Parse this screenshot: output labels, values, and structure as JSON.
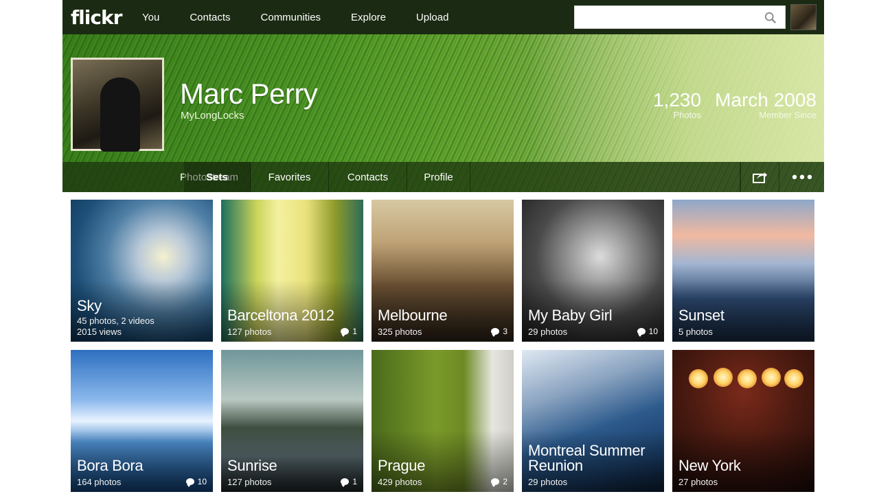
{
  "nav": {
    "logo": "flickr",
    "links": [
      "You",
      "Contacts",
      "Communities",
      "Explore",
      "Upload"
    ],
    "search_placeholder": "",
    "search_value": ""
  },
  "profile": {
    "name": "Marc Perry",
    "username": "MyLongLocks",
    "stats": [
      {
        "value": "1,230",
        "label": "Photos"
      },
      {
        "value": "March 2008",
        "label": "Member Since"
      }
    ]
  },
  "tabs": {
    "items": [
      "Photostream",
      "Sets",
      "Favorites",
      "Contacts",
      "Profile"
    ],
    "active": "Sets",
    "share_icon": "share-icon",
    "more_icon": "more-icon"
  },
  "sets": [
    {
      "title": "Sky",
      "meta1": "45 photos, 2 videos",
      "meta2": "2015 views",
      "comments": ""
    },
    {
      "title": "Barceltona 2012",
      "meta1": "127 photos",
      "meta2": "",
      "comments": "1"
    },
    {
      "title": "Melbourne",
      "meta1": "325 photos",
      "meta2": "",
      "comments": "3"
    },
    {
      "title": "My Baby Girl",
      "meta1": "29 photos",
      "meta2": "",
      "comments": "10"
    },
    {
      "title": "Sunset",
      "meta1": "5 photos",
      "meta2": "",
      "comments": ""
    },
    {
      "title": "Bora Bora",
      "meta1": "164 photos",
      "meta2": "",
      "comments": "10"
    },
    {
      "title": "Sunrise",
      "meta1": "127 photos",
      "meta2": "",
      "comments": "1"
    },
    {
      "title": "Prague",
      "meta1": "429 photos",
      "meta2": "",
      "comments": "2"
    },
    {
      "title": "Montreal Summer",
      "title2": "Reunion",
      "meta1": "29 photos",
      "meta2": "",
      "comments": ""
    },
    {
      "title": "New York",
      "meta1": "27 photos",
      "meta2": "",
      "comments": ""
    }
  ]
}
